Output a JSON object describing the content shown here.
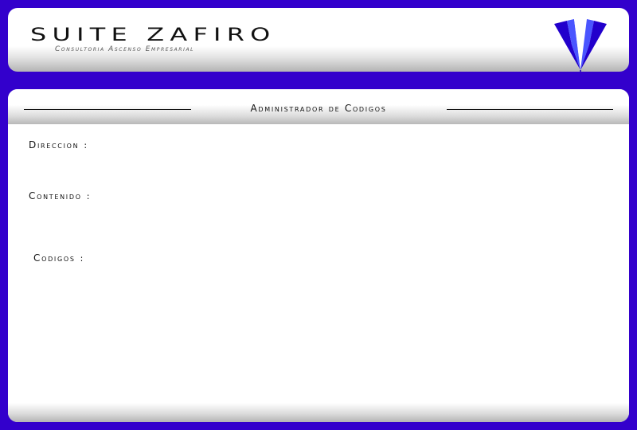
{
  "header": {
    "title": "SUITE ZAFIRO",
    "subtitle": "Consultoria Ascenso Empresarial",
    "logo_icon": "sapphire-gem-icon"
  },
  "main": {
    "section_title": "Administrador de Codigos",
    "fields": [
      {
        "label": "Direccion",
        "separator": ":"
      },
      {
        "label": "Contenido",
        "separator": ":"
      },
      {
        "label": "Codigos",
        "separator": ":"
      }
    ]
  },
  "colors": {
    "background": "#3300cc",
    "gem_dark": "#1a00b8",
    "gem_light": "#5a6bff"
  }
}
